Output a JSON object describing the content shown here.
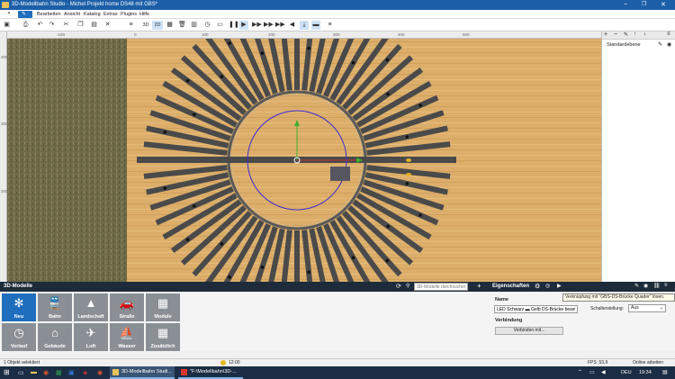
{
  "window": {
    "title": "3D-Modellbahn Studio - Michel Projekt home DS48 mit GBS*",
    "minimize": "−",
    "maximize": "❐",
    "close": "✕"
  },
  "menu": {
    "items": [
      "Bearbeiten",
      "Ansicht",
      "Katalog",
      "Extras",
      "Plugins",
      "Hilfe"
    ]
  },
  "toolbar": {
    "view_3d": "3D",
    "view_2d": "2D"
  },
  "ruler": {
    "top": [
      "-100",
      "0",
      "100",
      "200",
      "300",
      "400",
      "500"
    ],
    "left": [
      "400",
      "300",
      "200"
    ]
  },
  "layers": {
    "title": "Standardebene"
  },
  "models": {
    "header": "3D-Modelle",
    "search_placeholder": "3D-Modelle durchsuchen",
    "tiles": [
      "Neu",
      "Bahn",
      "Landschaft",
      "Straße",
      "Module",
      "Verlauf",
      "Gebäude",
      "Luft",
      "Wasser",
      "Zusätzlich"
    ]
  },
  "properties": {
    "header": "Eigenschaften",
    "tooltip": "Verknüpfung mit \"GBS-DS-Brücke Quader\" lösen.",
    "name_label": "Name",
    "name_value": "LED Schwarz ▬ Gelb DS-Brücke besetzt",
    "switch_label": "Schalterstellung:",
    "switch_value": "Aus",
    "connection_label": "Verbindung",
    "connect_button": "Verbinden mit..."
  },
  "status": {
    "selection": "1 Objekt selektiert",
    "time": "12:00",
    "fps": "FPS: 53,9",
    "online": "Online arbeiten"
  },
  "taskbar": {
    "app1": "3D-Modellbahn Studi...",
    "app2": "\"F:\\Modellbahn\\3D-...",
    "lang": "DEU",
    "clock": "19:34"
  },
  "colors": {
    "accent": "#1f6ebd",
    "panel_header": "#1d2b3a",
    "taskbar": "#1b2d44",
    "wood": "#d9ad6a",
    "track": "#4a4a4a",
    "pit_circle": "#3a2bd0"
  }
}
